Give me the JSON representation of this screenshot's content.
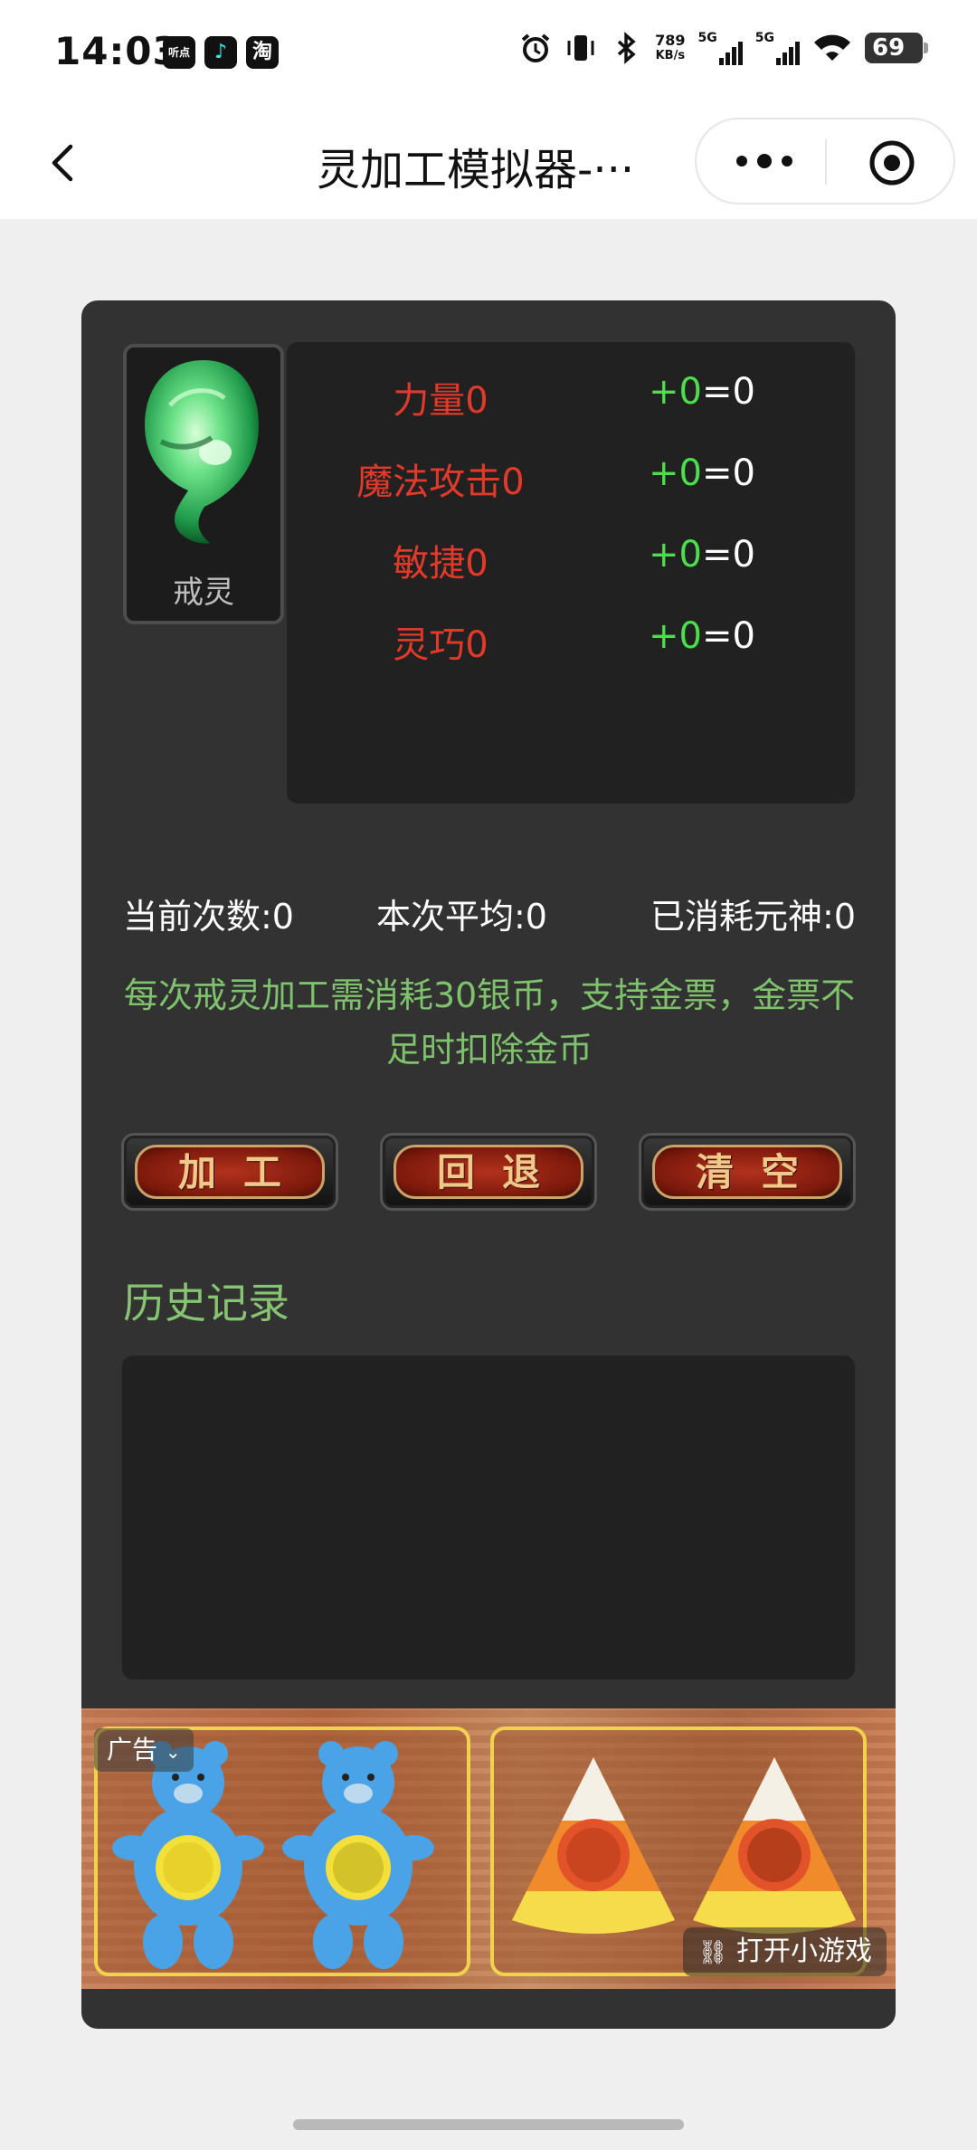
{
  "status_bar": {
    "time": "14:03",
    "apps": [
      "听点",
      "♪",
      "淘"
    ],
    "net_speed_value": "789",
    "net_speed_unit": "KB/s",
    "sim1": "5G",
    "sim2": "5G",
    "battery": "69"
  },
  "navbar": {
    "title": "灵加工模拟器-···"
  },
  "ring": {
    "name": "戒灵"
  },
  "attributes": [
    {
      "name": "力量0",
      "plus": "+0",
      "result": "=0"
    },
    {
      "name": "魔法攻击0",
      "plus": "+0",
      "result": "=0"
    },
    {
      "name": "敏捷0",
      "plus": "+0",
      "result": "=0"
    },
    {
      "name": "灵巧0",
      "plus": "+0",
      "result": "=0"
    }
  ],
  "stats": {
    "current_count": "当前次数:0",
    "average": "本次平均:0",
    "consumed": "已消耗元神:0"
  },
  "notice": "每次戒灵加工需消耗30银币，支持金票，金票不足时扣除金币",
  "buttons": {
    "process": "加工",
    "rollback": "回退",
    "clear": "清空"
  },
  "history": {
    "title": "历史记录"
  },
  "ad": {
    "tag": "广告",
    "cta": "打开小游戏"
  },
  "colors": {
    "panel_bg": "#323232",
    "box_bg": "#212121",
    "attr_red": "#e23a2a",
    "plus_green": "#4be04b",
    "notice_green": "#7fc26c"
  }
}
